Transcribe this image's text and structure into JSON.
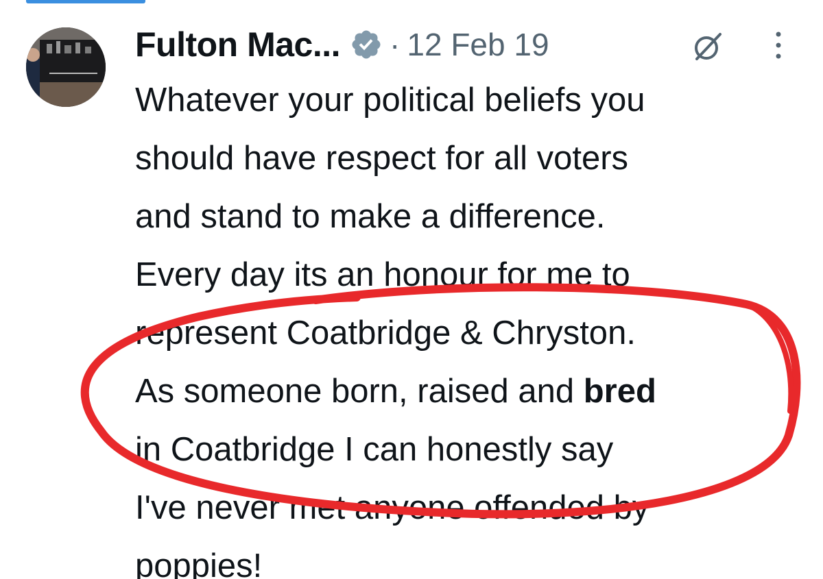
{
  "tweet": {
    "author_name": "Fulton Mac...",
    "separator": "·",
    "timestamp": "12 Feb 19",
    "lines": [
      "Whatever your political beliefs you",
      "should have respect for all voters",
      "and stand to make a difference.",
      "Every day its an honour for me to",
      "represent Coatbridge & Chryston.",
      "As someone born, raised and ",
      "in Coatbridge I can honestly say",
      "I've never met anyone offended by",
      "poppies!"
    ],
    "bold_word": "bred"
  },
  "icons": {
    "verified": "verified-badge-icon",
    "grok": "grok-icon",
    "more": "more-vertical-icon"
  },
  "colors": {
    "text": "#0f1419",
    "muted": "#536471",
    "annotation": "#e8292b",
    "accent": "#3b8fe0"
  }
}
